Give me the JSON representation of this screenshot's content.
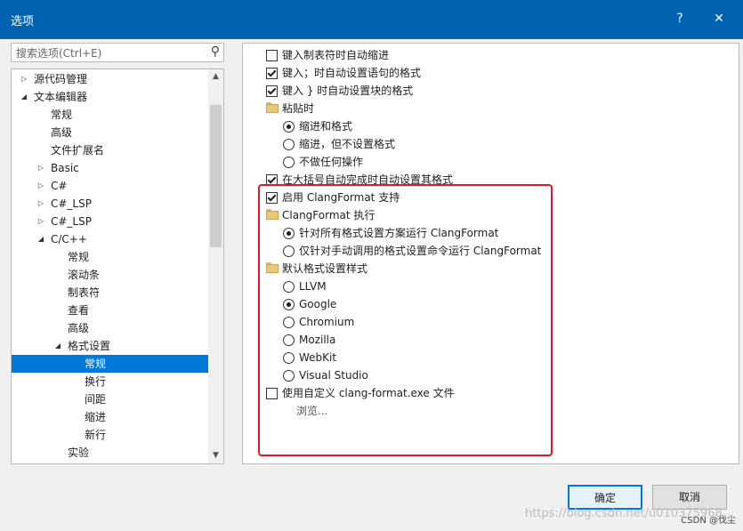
{
  "window": {
    "title": "选项",
    "help_label": "?",
    "close_label": "✕"
  },
  "search": {
    "placeholder": "搜索选项(Ctrl+E)"
  },
  "tree": {
    "items": [
      {
        "label": "源代码管理",
        "level": 0,
        "arrow": "right"
      },
      {
        "label": "文本编辑器",
        "level": 0,
        "arrow": "down"
      },
      {
        "label": "常规",
        "level": 1,
        "arrow": ""
      },
      {
        "label": "高级",
        "level": 1,
        "arrow": ""
      },
      {
        "label": "文件扩展名",
        "level": 1,
        "arrow": ""
      },
      {
        "label": "Basic",
        "level": 1,
        "arrow": "right"
      },
      {
        "label": "C#",
        "level": 1,
        "arrow": "right"
      },
      {
        "label": "C#_LSP",
        "level": 1,
        "arrow": "right"
      },
      {
        "label": "C#_LSP",
        "level": 1,
        "arrow": "right"
      },
      {
        "label": "C/C++",
        "level": 1,
        "arrow": "down"
      },
      {
        "label": "常规",
        "level": 2,
        "arrow": ""
      },
      {
        "label": "滚动条",
        "level": 2,
        "arrow": ""
      },
      {
        "label": "制表符",
        "level": 2,
        "arrow": ""
      },
      {
        "label": "查看",
        "level": 2,
        "arrow": ""
      },
      {
        "label": "高级",
        "level": 2,
        "arrow": ""
      },
      {
        "label": "格式设置",
        "level": 2,
        "arrow": "down"
      },
      {
        "label": "常规",
        "level": 3,
        "arrow": "",
        "selected": true
      },
      {
        "label": "换行",
        "level": 3,
        "arrow": ""
      },
      {
        "label": "间距",
        "level": 3,
        "arrow": ""
      },
      {
        "label": "缩进",
        "level": 3,
        "arrow": ""
      },
      {
        "label": "新行",
        "level": 3,
        "arrow": ""
      },
      {
        "label": "实验",
        "level": 2,
        "arrow": ""
      }
    ]
  },
  "options": [
    {
      "kind": "checkbox",
      "checked": false,
      "indent": 0,
      "label": "键入制表符时自动缩进"
    },
    {
      "kind": "checkbox",
      "checked": true,
      "indent": 0,
      "label": "键入；时自动设置语句的格式"
    },
    {
      "kind": "checkbox",
      "checked": true,
      "indent": 0,
      "label": "键入 } 时自动设置块的格式"
    },
    {
      "kind": "folder",
      "indent": 0,
      "label": "粘贴时"
    },
    {
      "kind": "radio",
      "checked": true,
      "indent": 1,
      "label": "缩进和格式"
    },
    {
      "kind": "radio",
      "checked": false,
      "indent": 1,
      "label": "缩进，但不设置格式"
    },
    {
      "kind": "radio",
      "checked": false,
      "indent": 1,
      "label": "不做任何操作"
    },
    {
      "kind": "checkbox",
      "checked": true,
      "indent": 0,
      "label": "在大括号自动完成时自动设置其格式"
    },
    {
      "kind": "checkbox",
      "checked": true,
      "indent": 0,
      "label": "启用 ClangFormat 支持"
    },
    {
      "kind": "folder",
      "indent": 0,
      "label": "ClangFormat 执行"
    },
    {
      "kind": "radio",
      "checked": true,
      "indent": 1,
      "label": "针对所有格式设置方案运行 ClangFormat"
    },
    {
      "kind": "radio",
      "checked": false,
      "indent": 1,
      "label": "仅针对手动调用的格式设置命令运行 ClangFormat"
    },
    {
      "kind": "folder",
      "indent": 0,
      "label": "默认格式设置样式"
    },
    {
      "kind": "radio",
      "checked": false,
      "indent": 1,
      "label": "LLVM"
    },
    {
      "kind": "radio",
      "checked": true,
      "indent": 1,
      "label": "Google"
    },
    {
      "kind": "radio",
      "checked": false,
      "indent": 1,
      "label": "Chromium"
    },
    {
      "kind": "radio",
      "checked": false,
      "indent": 1,
      "label": "Mozilla"
    },
    {
      "kind": "radio",
      "checked": false,
      "indent": 1,
      "label": "WebKit"
    },
    {
      "kind": "radio",
      "checked": false,
      "indent": 1,
      "label": "Visual Studio"
    },
    {
      "kind": "checkbox",
      "checked": false,
      "indent": 0,
      "label": "使用自定义 clang-format.exe 文件"
    },
    {
      "kind": "link",
      "indent": 1,
      "label": "浏览..."
    }
  ],
  "buttons": {
    "ok_label": "确定",
    "cancel_label": "取消"
  },
  "watermark": {
    "url_text": "https://blog.csdn.net/u010375968",
    "brand_text": "CSDN @伐尘"
  },
  "colors": {
    "title_bar": "#0063b1",
    "selection": "#0078d7",
    "highlight_outline": "#e0162b"
  }
}
